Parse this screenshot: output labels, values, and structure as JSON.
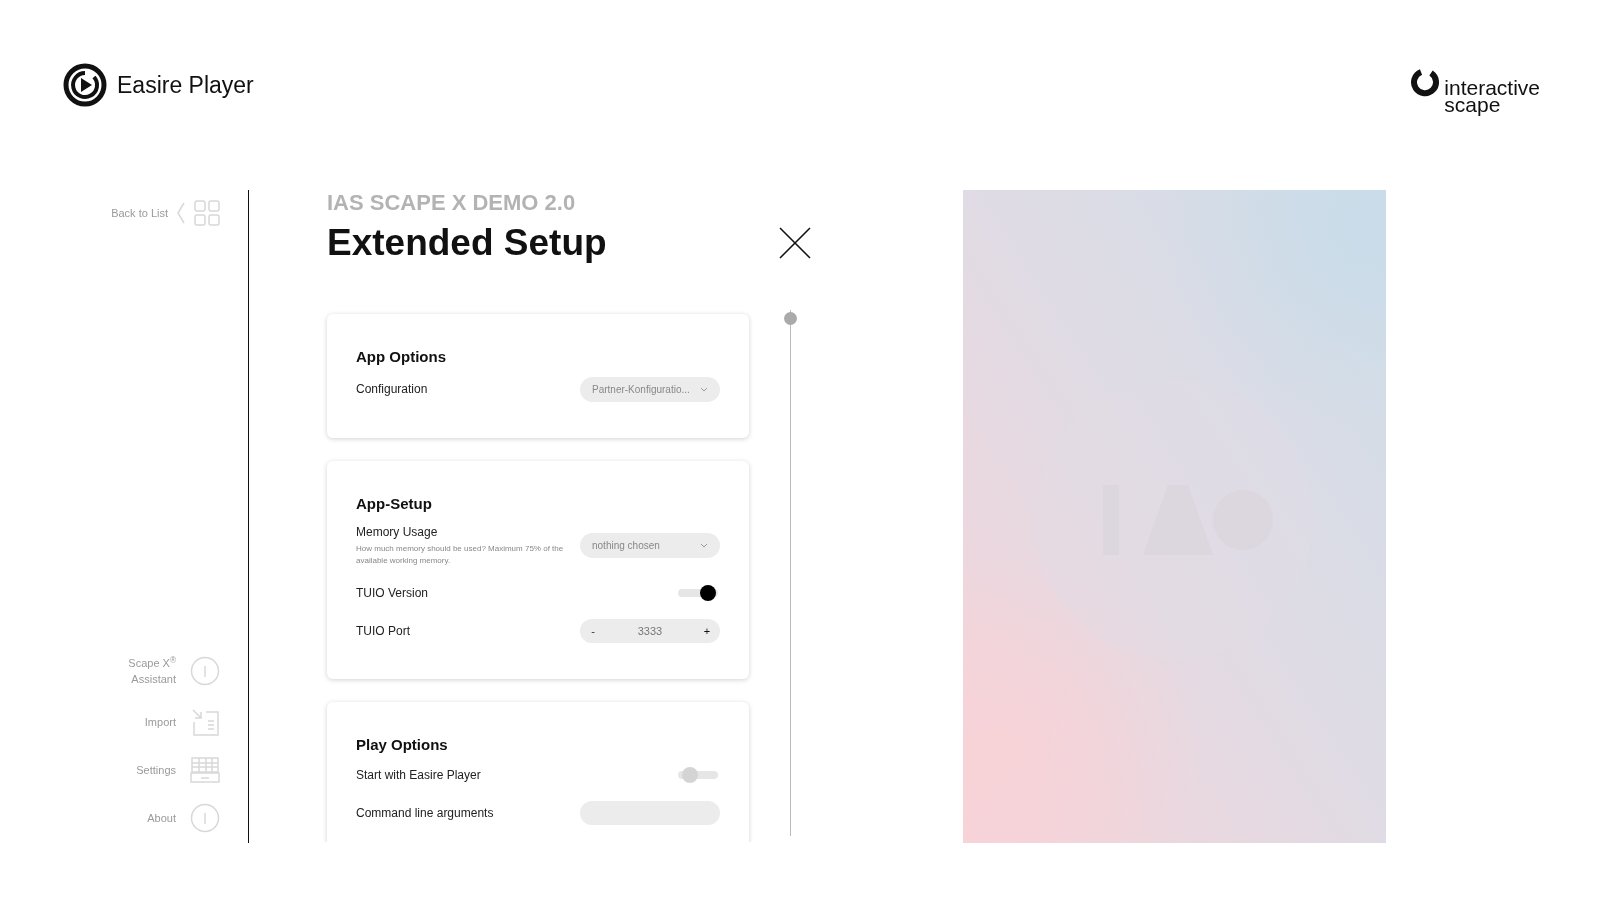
{
  "header": {
    "app_name": "Easire Player",
    "brand_lines": [
      "interactive",
      "scape"
    ]
  },
  "sidebar": {
    "back": {
      "label": "Back to List"
    },
    "items": [
      {
        "label": "Scape X$^{®}$ Assistant",
        "kind": "info"
      },
      {
        "label": "Import",
        "kind": "import"
      },
      {
        "label": "Settings",
        "kind": "settings"
      },
      {
        "label": "About",
        "kind": "info"
      }
    ]
  },
  "panel": {
    "subtitle": "IAS SCAPE X DEMO 2.0",
    "title": "Extended Setup",
    "sections": [
      {
        "title": "App Options",
        "rows": [
          {
            "kind": "select",
            "label": "Configuration",
            "value": "Partner-Konfiguratio..."
          }
        ]
      },
      {
        "title": "App-Setup",
        "rows": [
          {
            "kind": "select",
            "label": "Memory Usage",
            "hint": "How much memory should be used? Maximum 75% of the available working memory.",
            "value": "nothing chosen"
          },
          {
            "kind": "toggle",
            "label": "TUIO Version",
            "on": true
          },
          {
            "kind": "stepper",
            "label": "TUIO Port",
            "minus": "-",
            "value": "3333",
            "plus": "+"
          }
        ]
      },
      {
        "title": "Play Options",
        "rows": [
          {
            "kind": "toggle",
            "label": "Start with Easire Player",
            "on": false
          },
          {
            "kind": "text",
            "label": "Command line arguments"
          }
        ]
      }
    ]
  }
}
